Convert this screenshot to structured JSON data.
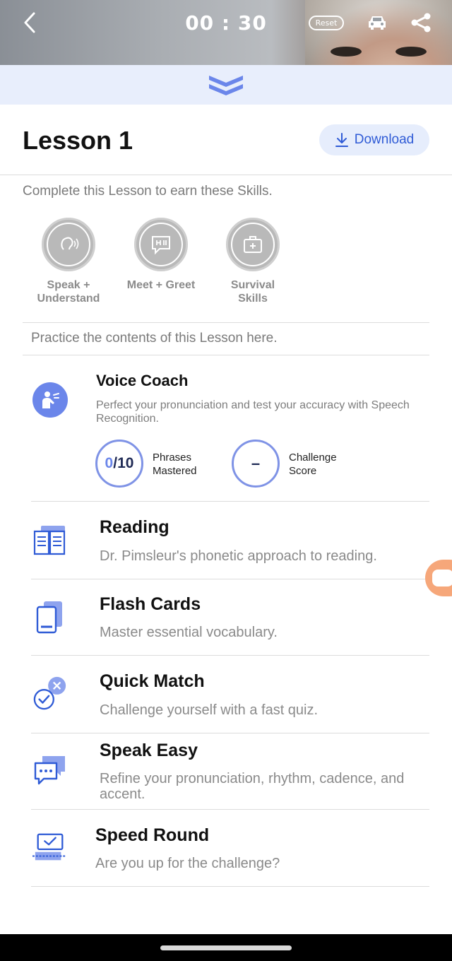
{
  "header": {
    "timer": "00 : 30",
    "reset_label": "Reset",
    "icons": [
      "chevron-left-icon",
      "car-icon",
      "share-icon"
    ]
  },
  "lesson": {
    "title": "Lesson 1",
    "download_label": "Download"
  },
  "skills": {
    "intro": "Complete this Lesson to earn these Skills.",
    "items": [
      {
        "label_line1": "Speak +",
        "label_line2": "Understand",
        "icon": "ear-sound-icon"
      },
      {
        "label_line1": "Meet + Greet",
        "label_line2": "",
        "icon": "speech-bubble-hi-icon"
      },
      {
        "label_line1": "Survival",
        "label_line2": "Skills",
        "icon": "first-aid-kit-icon"
      }
    ]
  },
  "practice": {
    "intro": "Practice the contents of this Lesson here.",
    "voice_coach": {
      "title": "Voice Coach",
      "description": "Perfect your pronunciation and test your accuracy with Speech Recognition.",
      "phrases_done": "0",
      "phrases_total": "/10",
      "phrases_label_1": "Phrases",
      "phrases_label_2": "Mastered",
      "challenge_value": "–",
      "challenge_label_1": "Challenge",
      "challenge_label_2": "Score"
    },
    "items": [
      {
        "title": "Reading",
        "description": "Dr. Pimsleur's phonetic approach to reading.",
        "icon": "book-icon"
      },
      {
        "title": "Flash Cards",
        "description": "Master essential vocabulary.",
        "icon": "flash-cards-icon"
      },
      {
        "title": "Quick Match",
        "description": "Challenge yourself with a fast quiz.",
        "icon": "check-x-icon"
      },
      {
        "title": "Speak Easy",
        "description": "Refine your pronunciation, rhythm, cadence, and accent.",
        "icon": "chat-bubbles-icon"
      },
      {
        "title": "Speed Round",
        "description": "Are you up for the challenge?",
        "icon": "speed-round-icon"
      }
    ]
  },
  "colors": {
    "accent": "#6b86ea",
    "link": "#2f5bd6",
    "collapse_bar": "#e8eefc",
    "side_tab": "#f6a77a"
  }
}
